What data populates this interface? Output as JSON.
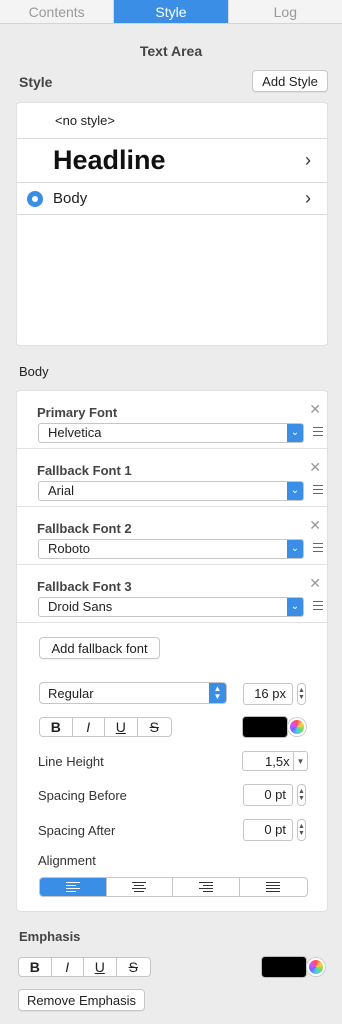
{
  "tabs": [
    {
      "label": "Contents",
      "active": false
    },
    {
      "label": "Style",
      "active": true
    },
    {
      "label": "Log",
      "active": false
    }
  ],
  "panel_title": "Text Area",
  "style_section": {
    "title": "Style",
    "add_button": "Add Style",
    "items": [
      {
        "label": "<no style>",
        "selected": false,
        "has_children": false
      },
      {
        "label": "Headline",
        "selected": false,
        "has_children": true
      },
      {
        "label": "Body",
        "selected": true,
        "has_children": true
      }
    ]
  },
  "body_section": {
    "title": "Body",
    "fonts": [
      {
        "label": "Primary Font",
        "value": "Helvetica"
      },
      {
        "label": "Fallback Font 1",
        "value": "Arial"
      },
      {
        "label": "Fallback Font 2",
        "value": "Roboto"
      },
      {
        "label": "Fallback Font 3",
        "value": "Droid Sans"
      }
    ],
    "add_fallback_button": "Add fallback font",
    "weight": "Regular",
    "font_size": "16 px",
    "format_buttons": [
      "B",
      "I",
      "U",
      "S"
    ],
    "text_color": "#000000",
    "line_height_label": "Line Height",
    "line_height_value": "1,5x",
    "spacing_before_label": "Spacing Before",
    "spacing_before_value": "0 pt",
    "spacing_after_label": "Spacing After",
    "spacing_after_value": "0 pt",
    "alignment_label": "Alignment",
    "alignment_selected": "left"
  },
  "emphasis_section": {
    "title": "Emphasis",
    "format_buttons": [
      "B",
      "I",
      "U",
      "S"
    ],
    "color": "#000000",
    "remove_button": "Remove Emphasis"
  },
  "colors": {
    "accent": "#3a8ee6",
    "background": "#ececec",
    "card": "#ffffff"
  },
  "icons": [
    "chevron-right-icon",
    "radio-selected-icon",
    "close-icon",
    "drag-handle-icon",
    "dropdown-arrow-icon",
    "stepper-icon",
    "color-wheel-icon",
    "align-left-icon",
    "align-center-icon",
    "align-right-icon",
    "align-justify-icon"
  ]
}
